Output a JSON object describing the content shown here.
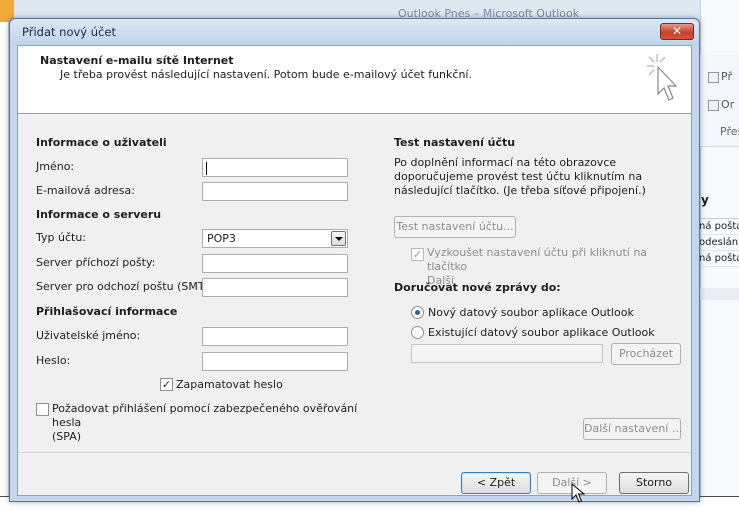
{
  "background": {
    "window_title": "Outlook Pnes – Microsoft Outlook",
    "ribbon_items": [
      "Př",
      "Or"
    ],
    "ribbon_group": "Přes",
    "pane_header": "y",
    "list_items": [
      "ná pošta",
      "odesláni",
      "ná pošta"
    ]
  },
  "dialog": {
    "title": "Přidat nový účet",
    "close_label": "✕",
    "header_title": "Nastavení e-mailu sítě Internet",
    "header_subtitle": "Je třeba provést následující nastavení. Potom bude e-mailový účet funkční.",
    "sections": {
      "user_info": "Informace o uživateli",
      "server_info": "Informace o serveru",
      "login_info": "Přihlašovací informace",
      "test_settings": "Test nastavení účtu",
      "deliver_to": "Doručovat nové zprávy do:"
    },
    "fields": {
      "name_label": "Jméno:",
      "name_value": "",
      "email_label": "E-mailová adresa:",
      "email_value": "",
      "account_type_label": "Typ účtu:",
      "account_type_value": "POP3",
      "incoming_label": "Server příchozí pošty:",
      "incoming_value": "",
      "outgoing_label": "Server pro odchozí poštu (SMTP):",
      "outgoing_value": "",
      "username_label": "Uživatelské jméno:",
      "username_value": "",
      "password_label": "Heslo:",
      "password_value": "",
      "remember_password_label": "Zapamatovat heslo",
      "spa_label_line1": "Požadovat přihlášení pomocí zabezpečeného ověřování hesla",
      "spa_label_line2": "(SPA)",
      "existing_file_value": ""
    },
    "test": {
      "description": "Po doplnění informací na této obrazovce doporučujeme provést test účtu kliknutím na následující tlačítko. (Je třeba síťové připojení.)",
      "button_label": "Test nastavení účtu...",
      "auto_test_label_line1": "Vyzkoušet nastavení účtu při kliknutí na tlačítko",
      "auto_test_label_line2": "Další"
    },
    "delivery": {
      "new_file_label": "Nový datový soubor aplikace Outlook",
      "existing_file_label": "Existující datový soubor aplikace Outlook",
      "browse_label": "Procházet",
      "selected": "new"
    },
    "buttons": {
      "more_settings": "Další nastavení ...",
      "back": "< Zpět",
      "next": "Další >",
      "cancel": "Storno"
    },
    "checks": {
      "remember_password": true,
      "spa": false,
      "auto_test": true
    }
  }
}
